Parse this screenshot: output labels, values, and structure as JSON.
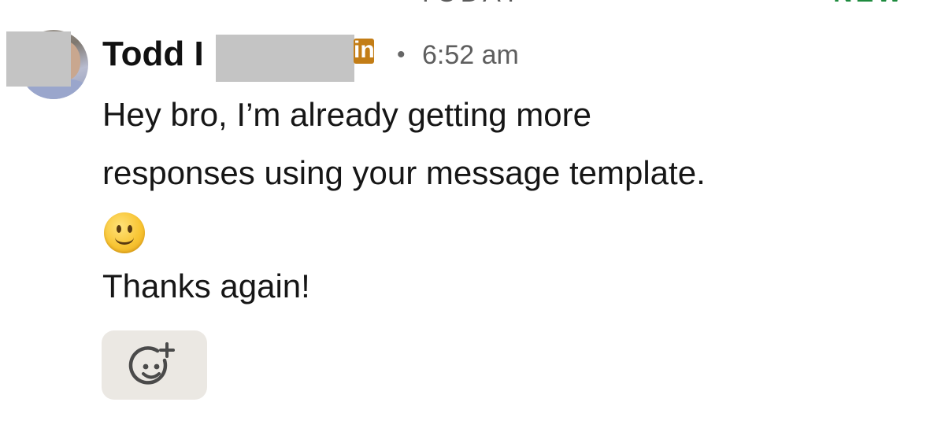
{
  "divider": {
    "date_label": "TODAY",
    "new_label": "NEW"
  },
  "message": {
    "sender": "Todd I",
    "badge": "in",
    "separator": "•",
    "time": "6:52 am",
    "lines": [
      "Hey bro, I’m already getting more",
      "responses using your message template.",
      "Thanks again!"
    ],
    "emoji": "slightly-smiling-face"
  },
  "reaction": {
    "icon": "add-reaction-icon"
  },
  "colors": {
    "badge": "#c37d16",
    "reaction_bg": "#ebe8e3",
    "redaction": "#c4c4c4",
    "new_label": "#1e8a3e"
  }
}
